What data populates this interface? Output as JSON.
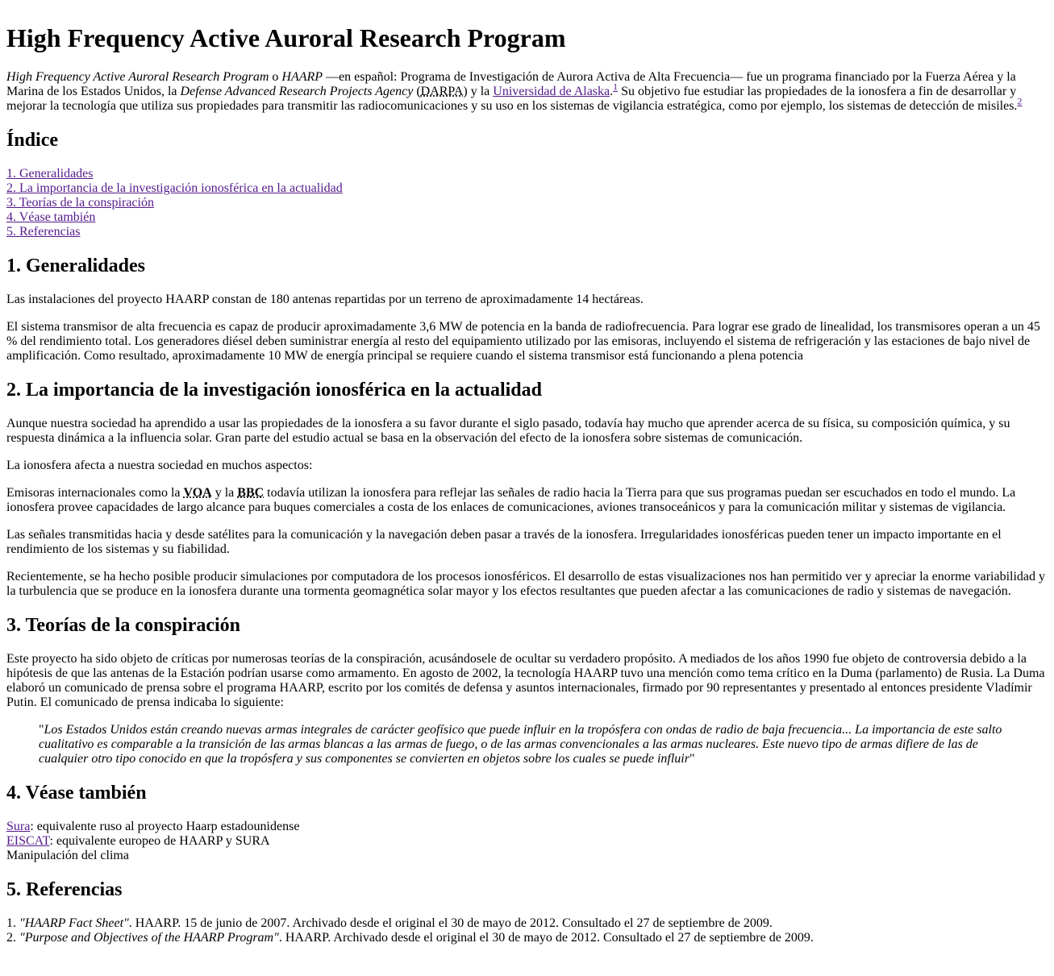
{
  "title": "High Frequency Active Auroral Research Program",
  "intro": {
    "name_en": "High Frequency Active Auroral Research Program",
    "o": " o ",
    "acronym": "HAARP",
    "t1": " —en español: Programa de Investigación de Aurora Activa de Alta Frecuencia— fue un programa financiado por la Fuerza Aérea y la Marina de los Estados Unidos, la ",
    "darpa_full": "Defense Advanced Research Projects Agency",
    "t2": " (",
    "darpa": "DARPA",
    "t3": ") y la ",
    "alaska_link": "Universidad de Alaska",
    "t4": ".",
    "ref1": "1",
    "t5": " Su objetivo fue estudiar las propiedades de la ionosfera a fin de desarrollar y mejorar la tecnología que utiliza sus propiedades para transmitir las radiocomunicaciones y su uso en los sistemas de vigilancia estratégica, como por ejemplo, los sistemas de detección de misiles.",
    "ref2": "2"
  },
  "toc": {
    "heading": "Índice",
    "items": [
      "1. Generalidades",
      "2. La importancia de la investigación ionosférica en la actualidad",
      "3. Teorías de la conspiración",
      "4. Véase también",
      "5. Referencias"
    ]
  },
  "s1": {
    "heading": "1. Generalidades",
    "p1": "Las instalaciones del proyecto HAARP constan de 180 antenas repartidas por un terreno de aproximadamente 14 hectáreas.",
    "p2": "El sistema transmisor de alta frecuencia es capaz de producir aproximadamente 3,6 MW de potencia en la banda de radiofrecuencia. Para lograr ese grado de linealidad, los transmisores operan a un 45 % del rendimiento total. Los generadores diésel deben suministrar energía al resto del equipamiento utilizado por las emisoras, incluyendo el sistema de refrigeración y las estaciones de bajo nivel de amplificación. Como resultado, aproximadamente 10 MW de energía principal se requiere cuando el sistema transmisor está funcionando a plena potencia"
  },
  "s2": {
    "heading": "2. La importancia de la investigación ionosférica en la actualidad",
    "p1": "Aunque nuestra sociedad ha aprendido a usar las propiedades de la ionosfera a su favor durante el siglo pasado, todavía hay mucho que aprender acerca de su física, su composición química, y su respuesta dinámica a la influencia solar. Gran parte del estudio actual se basa en la observación del efecto de la ionosfera sobre sistemas de comunicación.",
    "p2": "La ionosfera afecta a nuestra sociedad en muchos aspectos:",
    "p3a": "Emisoras internacionales como la ",
    "voa": "VOA",
    "p3b": " y la ",
    "bbc": "BBC",
    "p3c": " todavía utilizan la ionosfera para reflejar las señales de radio hacia la Tierra para que sus programas puedan ser escuchados en todo el mundo. La ionosfera provee capacidades de largo alcance para buques comerciales a costa de los enlaces de comunicaciones, aviones transoceánicos y para la comunicación militar y sistemas de vigilancia.",
    "p4": "Las señales transmitidas hacia y desde satélites para la comunicación y la navegación deben pasar a través de la ionosfera. Irregularidades ionosféricas pueden tener un impacto importante en el rendimiento de los sistemas y su fiabilidad.",
    "p5": "Recientemente, se ha hecho posible producir simulaciones por computadora de los procesos ionosféricos. El desarrollo de estas visualizaciones nos han permitido ver y apreciar la enorme variabilidad y la turbulencia que se produce en la ionosfera durante una tormenta geomagnética solar mayor y los efectos resultantes que pueden afectar a las comunicaciones de radio y sistemas de navegación."
  },
  "s3": {
    "heading": "3. Teorías de la conspiración",
    "p1": "Este proyecto ha sido objeto de críticas por numerosas teorías de la conspiración, acusándosele de ocultar su verdadero propósito. A mediados de los años 1990 fue objeto de controversia debido a la hipótesis de que las antenas de la Estación podrían usarse como armamento. En agosto de 2002, la tecnología HAARP tuvo una mención como tema crítico en la Duma (parlamento) de Rusia. La Duma elaboró un comunicado de prensa sobre el programa HAARP, escrito por los comités de defensa y asuntos internacionales, firmado por 90 representantes y presentado al entonces presidente Vladímir Putin. El comunicado de prensa indicaba lo siguiente:",
    "quote_open": "\"",
    "quote": "Los Estados Unidos están creando nuevas armas integrales de carácter geofísico que puede influir en la tropósfera con ondas de radio de baja frecuencia... La importancia de este salto cualitativo es comparable a la transición de las armas blancas a las armas de fuego, o de las armas convencionales a las armas nucleares. Este nuevo tipo de armas difiere de las de cualquier otro tipo conocido en que la tropósfera y sus componentes se convierten en objetos sobre los cuales se puede influir",
    "quote_close": "\""
  },
  "s4": {
    "heading": "4. Véase también",
    "items": [
      {
        "link": "Sura",
        "text": ": equivalente ruso al proyecto Haarp estadounidense"
      },
      {
        "link": "EISCAT",
        "text": ": equivalente europeo de HAARP y SURA"
      },
      {
        "text": "Manipulación del clima"
      }
    ]
  },
  "s5": {
    "heading": "5. Referencias",
    "items": [
      {
        "num": "1. ",
        "title": "\"HAARP Fact Sheet\"",
        "text": ". HAARP. 15 de junio de 2007. Archivado desde el original el 30 de mayo de 2012. Consultado el 27 de septiembre de 2009."
      },
      {
        "num": "2. ",
        "title": "\"Purpose and Objectives of the HAARP Program\"",
        "text": ". HAARP. Archivado desde el original el 30 de mayo de 2012. Consultado el 27 de septiembre de 2009."
      }
    ]
  },
  "colors": {
    "link": "#551a8b",
    "text": "#000000",
    "background": "#ffffff"
  }
}
